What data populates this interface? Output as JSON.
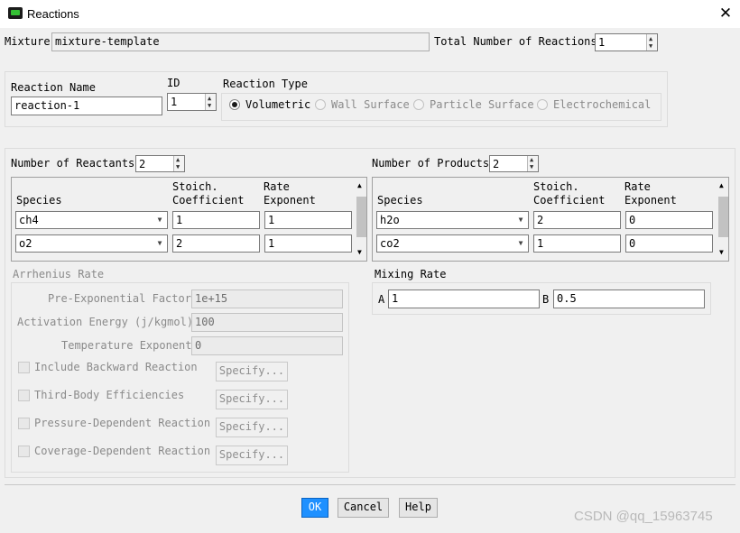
{
  "window": {
    "title": "Reactions",
    "icon": "fluent-app-icon",
    "close_icon": "close-icon"
  },
  "top": {
    "mixture_label": "Mixture",
    "mixture_value": "mixture-template",
    "total_label": "Total Number of Reactions",
    "total_value": "1"
  },
  "reaction": {
    "name_label": "Reaction Name",
    "name_value": "reaction-1",
    "id_label": "ID",
    "id_value": "1",
    "type_label": "Reaction Type",
    "types": [
      {
        "label": "Volumetric",
        "selected": true,
        "enabled": true
      },
      {
        "label": "Wall Surface",
        "selected": false,
        "enabled": false
      },
      {
        "label": "Particle Surface",
        "selected": false,
        "enabled": false
      },
      {
        "label": "Electrochemical",
        "selected": false,
        "enabled": false
      }
    ]
  },
  "reactants": {
    "count_label": "Number of Reactants",
    "count_value": "2",
    "headers": {
      "species": "Species",
      "stoich_1": "Stoich.",
      "stoich_2": "Coefficient",
      "rate_1": "Rate",
      "rate_2": "Exponent"
    },
    "rows": [
      {
        "species": "ch4",
        "coeff": "1",
        "exponent": "1"
      },
      {
        "species": "o2",
        "coeff": "2",
        "exponent": "1"
      }
    ]
  },
  "products": {
    "count_label": "Number of Products",
    "count_value": "2",
    "headers": {
      "species": "Species",
      "stoich_1": "Stoich.",
      "stoich_2": "Coefficient",
      "rate_1": "Rate",
      "rate_2": "Exponent"
    },
    "rows": [
      {
        "species": "h2o",
        "coeff": "2",
        "exponent": "0"
      },
      {
        "species": "co2",
        "coeff": "1",
        "exponent": "0"
      }
    ]
  },
  "arrhenius": {
    "title": "Arrhenius Rate",
    "pre_exp_label": "Pre-Exponential Factor",
    "pre_exp_value": "1e+15",
    "activation_label": "Activation Energy (j/kgmol)",
    "activation_value": "100",
    "temp_exp_label": "Temperature Exponent",
    "temp_exp_value": "0",
    "options": [
      {
        "label": "Include Backward Reaction",
        "button": "Specify..."
      },
      {
        "label": "Third-Body Efficiencies",
        "button": "Specify..."
      },
      {
        "label": "Pressure-Dependent Reaction",
        "button": "Specify..."
      },
      {
        "label": "Coverage-Dependent Reaction",
        "button": "Specify..."
      }
    ]
  },
  "mixing": {
    "title": "Mixing Rate",
    "a_label": "A",
    "a_value": "1",
    "b_label": "B",
    "b_value": "0.5"
  },
  "buttons": {
    "ok": "OK",
    "cancel": "Cancel",
    "help": "Help"
  },
  "watermark": "CSDN @qq_15963745",
  "colors": {
    "ok_button": "#1e90ff",
    "app_icon": "#35c035"
  }
}
